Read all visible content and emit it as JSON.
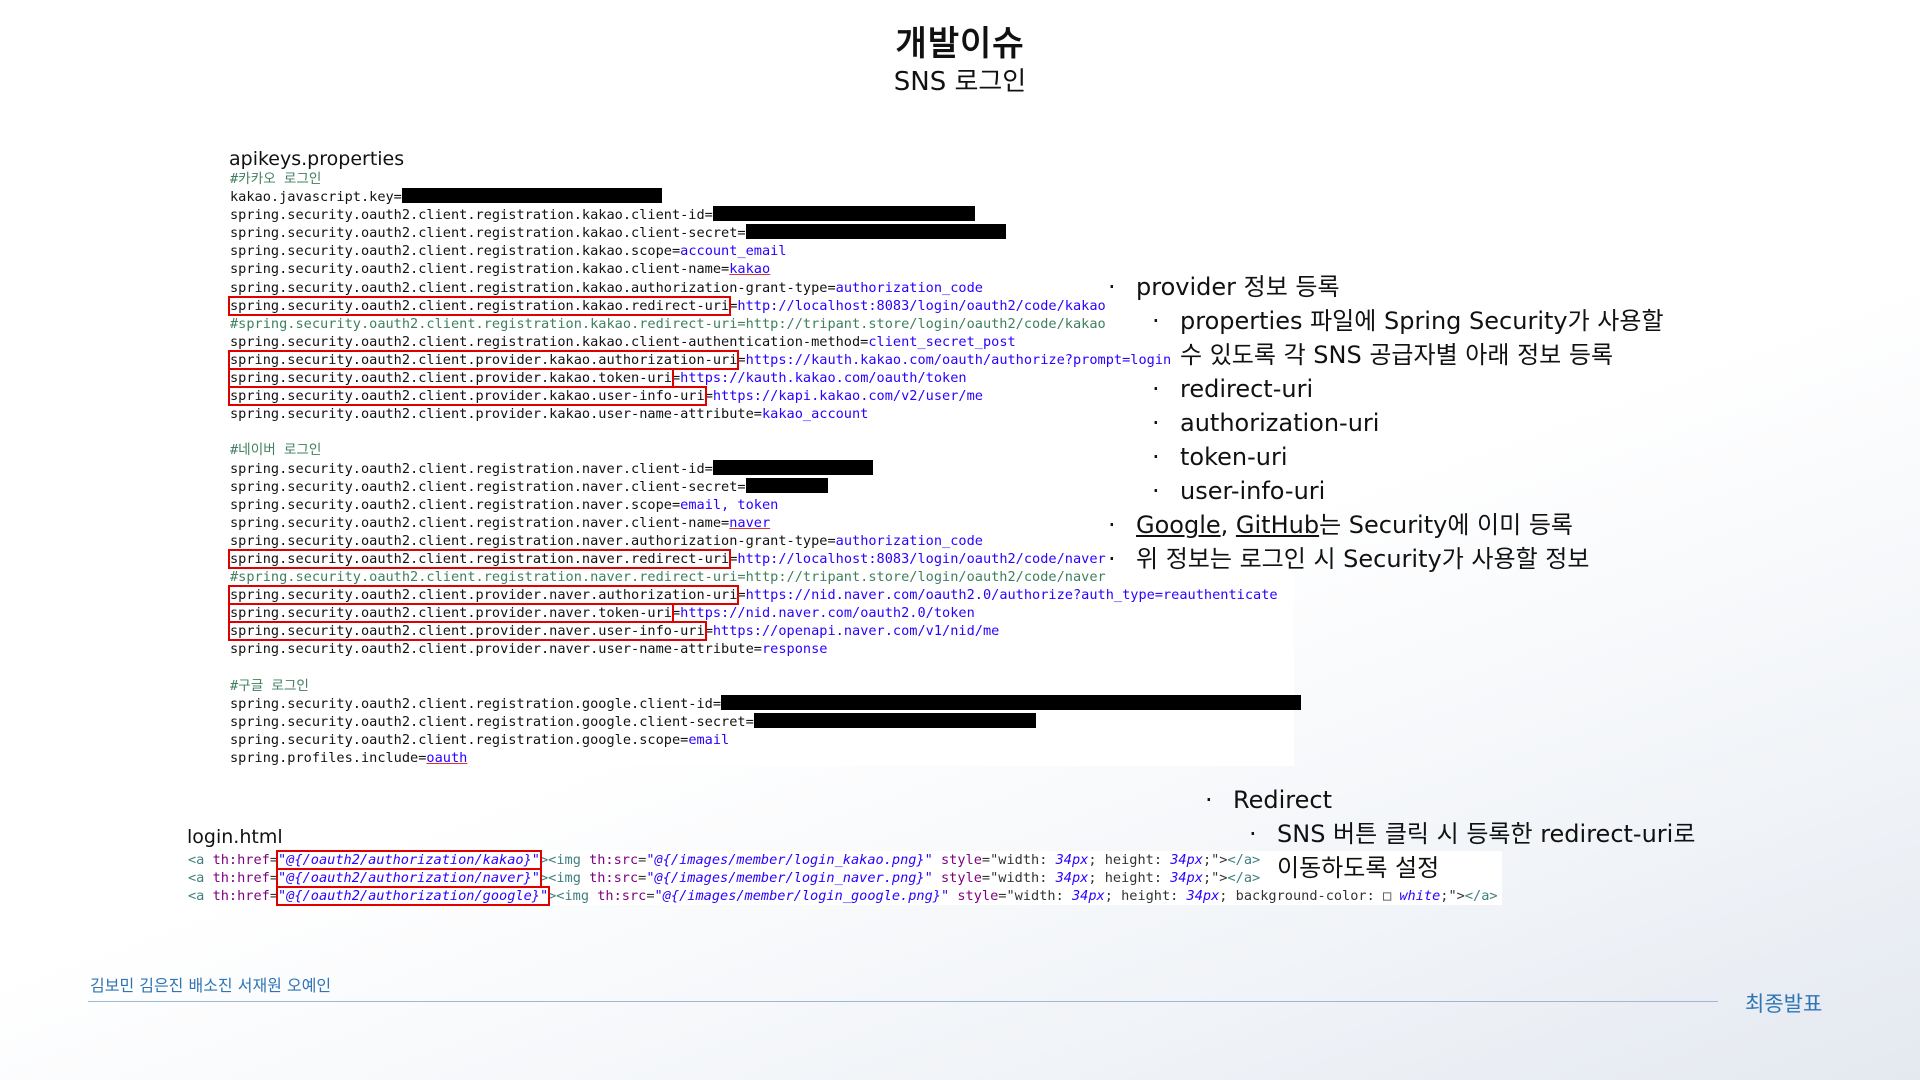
{
  "header": {
    "title": "개발이슈",
    "subtitle": "SNS 로그인"
  },
  "file1": {
    "label": "apikeys.properties",
    "lines": [
      {
        "parts": [
          {
            "t": "#카카오 로그인",
            "c": "cm"
          }
        ]
      },
      {
        "parts": [
          {
            "t": "kakao.javascript.key="
          },
          {
            "redact": 260
          }
        ]
      },
      {
        "parts": [
          {
            "t": "spring.security.oauth2.client.registration.kakao.client-id="
          },
          {
            "redact": 262
          }
        ]
      },
      {
        "parts": [
          {
            "t": "spring.security.oauth2.client.registration.kakao.client-secret="
          },
          {
            "redact": 260
          }
        ]
      },
      {
        "parts": [
          {
            "t": "spring.security.oauth2.client.registration.kakao.scope="
          },
          {
            "t": "account_email",
            "c": "val"
          }
        ]
      },
      {
        "parts": [
          {
            "t": "spring.security.oauth2.client.registration.kakao.client-name="
          },
          {
            "t": "kakao",
            "c": "val u"
          }
        ]
      },
      {
        "parts": [
          {
            "t": "spring.security.oauth2.client.registration.kakao.authorization-grant-type="
          },
          {
            "t": "authorization_code",
            "c": "val"
          }
        ]
      },
      {
        "parts": [
          {
            "t": "spring.security.oauth2.client.registration.kakao.redirect-uri",
            "box": true
          },
          {
            "t": "="
          },
          {
            "t": "http://localhost:8083/login/oauth2/code/kakao",
            "c": "val"
          }
        ]
      },
      {
        "parts": [
          {
            "t": "#spring.security.oauth2.client.registration.kakao.redirect-uri=http://tripant.store/login/oauth2/code/kakao",
            "c": "cm"
          }
        ]
      },
      {
        "parts": [
          {
            "t": "spring.security.oauth2.client.registration.kakao.client-authentication-method="
          },
          {
            "t": "client_secret_post",
            "c": "val"
          }
        ]
      },
      {
        "parts": [
          {
            "t": "spring.security.oauth2.client.provider.kakao.authorization-uri",
            "box": true
          },
          {
            "t": "="
          },
          {
            "t": "https://kauth.kakao.com/oauth/authorize?prompt=login",
            "c": "val"
          }
        ]
      },
      {
        "parts": [
          {
            "t": "spring.security.oauth2.client.provider.kakao.token-uri",
            "box": true
          },
          {
            "t": "="
          },
          {
            "t": "https://kauth.kakao.com/oauth/token",
            "c": "val"
          }
        ]
      },
      {
        "parts": [
          {
            "t": "spring.security.oauth2.client.provider.kakao.user-info-uri",
            "box": true
          },
          {
            "t": "="
          },
          {
            "t": "https://kapi.kakao.com/v2/user/me",
            "c": "val"
          }
        ]
      },
      {
        "parts": [
          {
            "t": "spring.security.oauth2.client.provider.kakao.user-name-attribute="
          },
          {
            "t": "kakao_account",
            "c": "val"
          }
        ]
      },
      {
        "parts": [
          {
            "t": " "
          }
        ]
      },
      {
        "parts": [
          {
            "t": "#네이버 로그인",
            "c": "cm"
          }
        ]
      },
      {
        "parts": [
          {
            "t": "spring.security.oauth2.client.registration.naver.client-id="
          },
          {
            "redact": 160
          }
        ]
      },
      {
        "parts": [
          {
            "t": "spring.security.oauth2.client.registration.naver.client-secret="
          },
          {
            "redact": 82
          }
        ]
      },
      {
        "parts": [
          {
            "t": "spring.security.oauth2.client.registration.naver.scope="
          },
          {
            "t": "email, token",
            "c": "val"
          }
        ]
      },
      {
        "parts": [
          {
            "t": "spring.security.oauth2.client.registration.naver.client-name="
          },
          {
            "t": "naver",
            "c": "val u"
          }
        ]
      },
      {
        "parts": [
          {
            "t": "spring.security.oauth2.client.registration.naver.authorization-grant-type="
          },
          {
            "t": "authorization_code",
            "c": "val"
          }
        ]
      },
      {
        "parts": [
          {
            "t": "spring.security.oauth2.client.registration.naver.redirect-uri",
            "box": true
          },
          {
            "t": "="
          },
          {
            "t": "http://localhost:8083/login/oauth2/code/naver",
            "c": "val"
          }
        ]
      },
      {
        "parts": [
          {
            "t": "#spring.security.oauth2.client.registration.naver.redirect-uri=http://tripant.store/login/oauth2/code/naver",
            "c": "cm"
          }
        ]
      },
      {
        "parts": [
          {
            "t": "spring.security.oauth2.client.provider.naver.authorization-uri",
            "box": true
          },
          {
            "t": "="
          },
          {
            "t": "https://nid.naver.com/oauth2.0/authorize?auth_type=reauthenticate",
            "c": "val"
          }
        ]
      },
      {
        "parts": [
          {
            "t": "spring.security.oauth2.client.provider.naver.token-uri",
            "box": true
          },
          {
            "t": "="
          },
          {
            "t": "https://nid.naver.com/oauth2.0/token",
            "c": "val"
          }
        ]
      },
      {
        "parts": [
          {
            "t": "spring.security.oauth2.client.provider.naver.user-info-uri",
            "box": true
          },
          {
            "t": "="
          },
          {
            "t": "https://openapi.naver.com/v1/nid/me",
            "c": "val"
          }
        ]
      },
      {
        "parts": [
          {
            "t": "spring.security.oauth2.client.provider.naver.user-name-attribute="
          },
          {
            "t": "response",
            "c": "val"
          }
        ]
      },
      {
        "parts": [
          {
            "t": " "
          }
        ]
      },
      {
        "parts": [
          {
            "t": "#구글 로그인",
            "c": "cm"
          }
        ]
      },
      {
        "parts": [
          {
            "t": "spring.security.oauth2.client.registration.google.client-id="
          },
          {
            "redact": 580
          }
        ]
      },
      {
        "parts": [
          {
            "t": "spring.security.oauth2.client.registration.google.client-secret="
          },
          {
            "redact": 282
          }
        ]
      },
      {
        "parts": [
          {
            "t": "spring.security.oauth2.client.registration.google.scope="
          },
          {
            "t": "email",
            "c": "val"
          }
        ]
      },
      {
        "parts": [
          {
            "t": "spring.profiles.include="
          },
          {
            "t": "oauth",
            "c": "val u"
          }
        ]
      }
    ]
  },
  "file2": {
    "label": "login.html",
    "lines": [
      {
        "parts": [
          {
            "t": "<a ",
            "c": "tag"
          },
          {
            "t": "th:href",
            "c": "attr"
          },
          {
            "t": "="
          },
          {
            "t": "\"@{/oauth2/authorization/kakao}\"",
            "c": "str",
            "box": true
          },
          {
            "t": "><img ",
            "c": "tag"
          },
          {
            "t": "th:src",
            "c": "attr"
          },
          {
            "t": "="
          },
          {
            "t": "\"@{/images/member/login_kakao.png}\"",
            "c": "str"
          },
          {
            "t": " style",
            "c": "attr"
          },
          {
            "t": "=\"width: "
          },
          {
            "t": "34px",
            "c": "num"
          },
          {
            "t": "; height: "
          },
          {
            "t": "34px",
            "c": "num"
          },
          {
            "t": ";\">"
          },
          {
            "t": "</a>",
            "c": "tag"
          }
        ]
      },
      {
        "parts": [
          {
            "t": "<a ",
            "c": "tag"
          },
          {
            "t": "th:href",
            "c": "attr"
          },
          {
            "t": "="
          },
          {
            "t": "\"@{/oauth2/authorization/naver}\"",
            "c": "str",
            "box": true
          },
          {
            "t": "><img ",
            "c": "tag"
          },
          {
            "t": "th:src",
            "c": "attr"
          },
          {
            "t": "="
          },
          {
            "t": "\"@{/images/member/login_naver.png}\"",
            "c": "str"
          },
          {
            "t": " style",
            "c": "attr"
          },
          {
            "t": "=\"width: "
          },
          {
            "t": "34px",
            "c": "num"
          },
          {
            "t": "; height: "
          },
          {
            "t": "34px",
            "c": "num"
          },
          {
            "t": ";\">"
          },
          {
            "t": "</a>",
            "c": "tag"
          }
        ]
      },
      {
        "parts": [
          {
            "t": "<a ",
            "c": "tag"
          },
          {
            "t": "th:href",
            "c": "attr"
          },
          {
            "t": "="
          },
          {
            "t": "\"@{/oauth2/authorization/google}\"",
            "c": "str",
            "box": true
          },
          {
            "t": "><img ",
            "c": "tag"
          },
          {
            "t": "th:src",
            "c": "attr"
          },
          {
            "t": "="
          },
          {
            "t": "\"@{/images/member/login_google.png}\"",
            "c": "str"
          },
          {
            "t": " style",
            "c": "attr"
          },
          {
            "t": "=\"width: "
          },
          {
            "t": "34px",
            "c": "num"
          },
          {
            "t": "; height: "
          },
          {
            "t": "34px",
            "c": "num"
          },
          {
            "t": "; background-color: □ "
          },
          {
            "t": "white",
            "c": "num"
          },
          {
            "t": ";\">"
          },
          {
            "t": "</a>",
            "c": "tag"
          }
        ]
      }
    ]
  },
  "notes1": [
    {
      "level": 1,
      "text": "provider 정보 등록"
    },
    {
      "level": 2,
      "text": "properties 파일에 Spring Security가 사용할"
    },
    {
      "level": 3,
      "text": "수 있도록 각 SNS 공급자별 아래 정보 등록"
    },
    {
      "level": 2,
      "text": "redirect-uri"
    },
    {
      "level": 2,
      "text": "authorization-uri"
    },
    {
      "level": 2,
      "text": "token-uri"
    },
    {
      "level": 2,
      "text": "user-info-uri"
    },
    {
      "level": 1,
      "text": "Google, GitHub는 Security에 이미 등록"
    },
    {
      "level": 1,
      "text": "위 정보는 로그인 시 Security가 사용할 정보"
    }
  ],
  "notes2": [
    {
      "level": 1,
      "text": "Redirect"
    },
    {
      "level": 2,
      "text": "SNS 버튼 클릭 시 등록한 redirect-uri로"
    },
    {
      "level": 3,
      "text": "이동하도록 설정"
    }
  ],
  "footer": {
    "names": "김보민 김은진 배소진 서재원 오예인",
    "right": "최종발표"
  }
}
